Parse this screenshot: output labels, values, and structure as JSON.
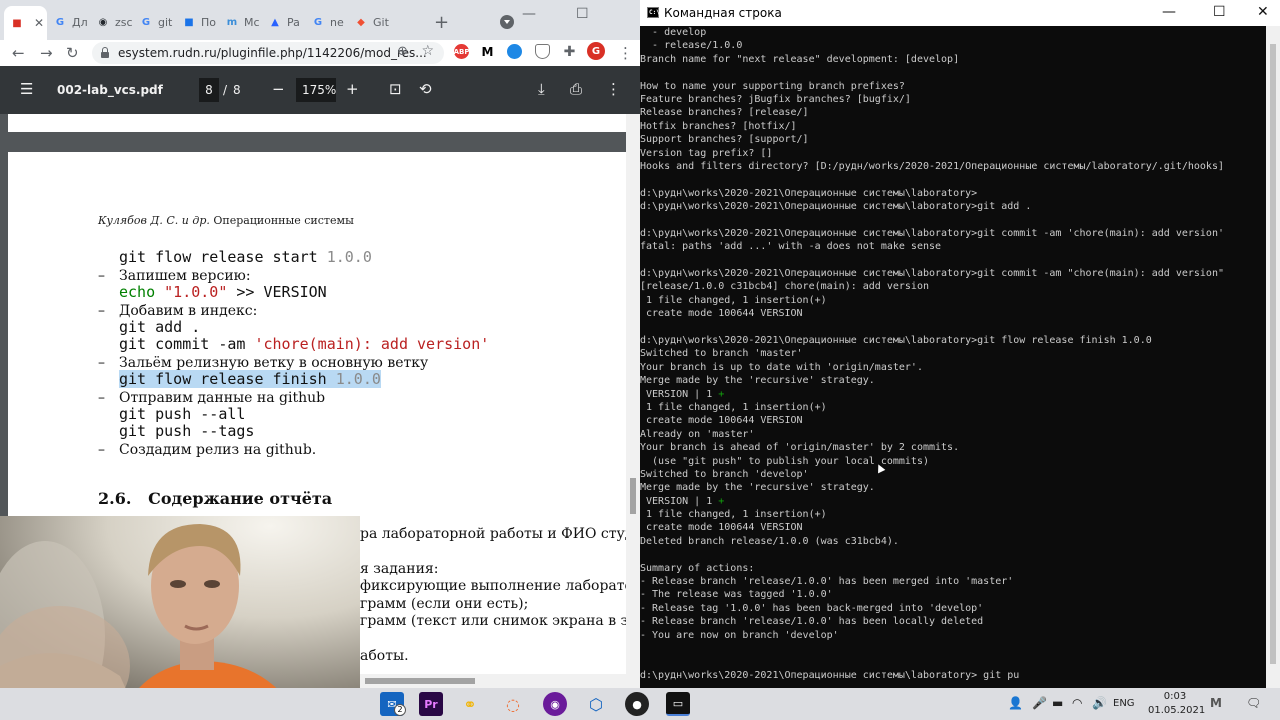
{
  "chrome": {
    "tabs": [
      {
        "icon": "rudn-logo-icon",
        "label": "",
        "color": "#d93025"
      },
      {
        "icon": "google-icon",
        "label": "Дл",
        "color": "#4285f4"
      },
      {
        "icon": "github-icon",
        "label": "zsc",
        "color": "#24292e"
      },
      {
        "icon": "google-icon",
        "label": "git",
        "color": "#4285f4"
      },
      {
        "icon": "blue-square-icon",
        "label": "По",
        "color": "#1a73e8"
      },
      {
        "icon": "moodle-icon",
        "label": "Mc",
        "color": "#3c8ed8"
      },
      {
        "icon": "pascal-triangle-icon",
        "label": "Pa",
        "color": "#2962ff"
      },
      {
        "icon": "google-icon",
        "label": "ne",
        "color": "#4285f4"
      },
      {
        "icon": "git-icon",
        "label": "Git",
        "color": "#f05033"
      }
    ],
    "url": "esystem.rudn.ru/pluginfile.php/1142206/mod_res...",
    "ext_abp": "ABP",
    "profile_initial": "G"
  },
  "pdf": {
    "title": "002-lab_vcs.pdf",
    "page_current": "8",
    "page_sep": "/",
    "page_total": "8",
    "zoom": "175%",
    "header_authors": "Кулябов Д. С. и др.",
    "header_title": "Операционные системы",
    "line1_cmd": "git flow release start ",
    "line1_ver": "1.0.0",
    "bullet_version": "Запишем версию:",
    "echo_kw": "echo",
    "echo_str": " \"1.0.0\"",
    "echo_rest": " >> VERSION",
    "bullet_index": "Добавим в индекс:",
    "git_add": "git add .",
    "commit_cmd": "git commit -am ",
    "commit_msg": "'chore(main): add version'",
    "bullet_merge": "Зальём релизную ветку в основную ветку",
    "finish_cmd": "git flow release finish",
    "finish_ver": " 1.0.0",
    "bullet_github": "Отправим данные на github",
    "push_all": "git push --all",
    "push_tags": "git push --tags",
    "bullet_release": "Создадим релиз на github.",
    "section_num": "2.6.",
    "section_title": "Содержание отчёта",
    "frag1": "ра лабораторной работы и ФИО студе",
    "frag2": "я задания:",
    "frag3": "фиксирующие выполнение лаборатор",
    "frag4": "грамм (если они есть);",
    "frag5": "грамм (текст или снимок экрана в зав",
    "frag6": "аботы."
  },
  "cmd": {
    "title": "Командная строка",
    "icon_text": "C:\\",
    "lines": [
      "  - develop",
      "  - release/1.0.0",
      "Branch name for \"next release\" development: [develop]",
      "",
      "How to name your supporting branch prefixes?",
      "Feature branches? jBugfix branches? [bugfix/]",
      "Release branches? [release/]",
      "Hotfix branches? [hotfix/]",
      "Support branches? [support/]",
      "Version tag prefix? []",
      "Hooks and filters directory? [D:/рудн/works/2020-2021/Операционные системы/laboratory/.git/hooks]",
      "",
      "d:\\рудн\\works\\2020-2021\\Операционные системы\\laboratory>",
      "d:\\рудн\\works\\2020-2021\\Операционные системы\\laboratory>git add .",
      "",
      "d:\\рудн\\works\\2020-2021\\Операционные системы\\laboratory>git commit -am 'chore(main): add version'",
      "fatal: paths 'add ...' with -a does not make sense",
      "",
      "d:\\рудн\\works\\2020-2021\\Операционные системы\\laboratory>git commit -am \"chore(main): add version\"",
      "[release/1.0.0 c31bcb4] chore(main): add version",
      " 1 file changed, 1 insertion(+)",
      " create mode 100644 VERSION",
      "",
      "d:\\рудн\\works\\2020-2021\\Операционные системы\\laboratory>git flow release finish 1.0.0",
      "Switched to branch 'master'",
      "Your branch is up to date with 'origin/master'.",
      "Merge made by the 'recursive' strategy.",
      " VERSION | 1 ",
      " 1 file changed, 1 insertion(+)",
      " create mode 100644 VERSION",
      "Already on 'master'",
      "Your branch is ahead of 'origin/master' by 2 commits.",
      "  (use \"git push\" to publish your local commits)",
      "Switched to branch 'develop'",
      "Merge made by the 'recursive' strategy.",
      " VERSION | 1 ",
      " 1 file changed, 1 insertion(+)",
      " create mode 100644 VERSION",
      "Deleted branch release/1.0.0 (was c31bcb4).",
      "",
      "Summary of actions:",
      "- Release branch 'release/1.0.0' has been merged into 'master'",
      "- The release was tagged '1.0.0'",
      "- Release tag '1.0.0' has been back-merged into 'develop'",
      "- Release branch 'release/1.0.0' has been locally deleted",
      "- You are now on branch 'develop'",
      "",
      "",
      "d:\\рудн\\works\\2020-2021\\Операционные системы\\laboratory> git pu"
    ],
    "plus_mark": "+"
  },
  "taskbar": {
    "mail_badge": "2",
    "premiere_label": "Pr",
    "lang": "ENG",
    "time": "0:03",
    "date": "01.05.2021"
  }
}
